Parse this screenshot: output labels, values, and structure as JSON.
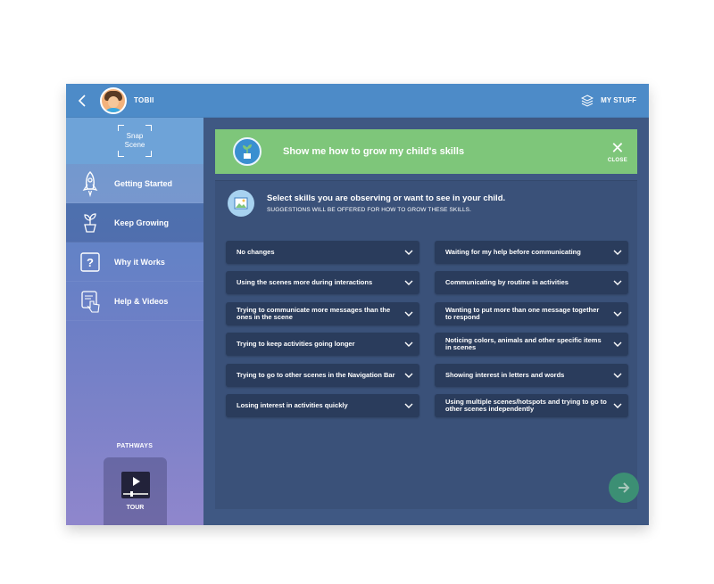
{
  "header": {
    "user_name": "TOBII",
    "my_stuff_label": "MY STUFF"
  },
  "sidebar": {
    "logo_line1": "Snap",
    "logo_line2": "Scene",
    "items": [
      {
        "label": "Getting Started",
        "icon": "rocket-icon"
      },
      {
        "label": "Keep Growing",
        "icon": "plant-icon"
      },
      {
        "label": "Why it Works",
        "icon": "question-icon"
      },
      {
        "label": "Help & Videos",
        "icon": "hand-touch-icon"
      }
    ],
    "pathways_label": "PATHWAYS",
    "tour_label": "TOUR"
  },
  "banner": {
    "title": "Show me how to grow my child's skills",
    "close_label": "CLOSE"
  },
  "panel": {
    "title": "Select skills you are observing or want to see in your child.",
    "subtitle": "SUGGESTIONS WILL BE OFFERED FOR HOW TO GROW THESE SKILLS."
  },
  "skills": [
    "No changes",
    "Waiting for my help before communicating",
    "Using the scenes more during interactions",
    "Communicating by routine in activities",
    "Trying to communicate more messages than the ones in the scene",
    "Wanting to put more than one message together to respond",
    "Trying to keep activities going longer",
    "Noticing colors, animals and other specific items in scenes",
    "Trying to go to other scenes in the Navigation Bar",
    "Showing interest in letters and words",
    "Losing interest in activities quickly",
    "Using multiple scenes/hotspots and trying to go to other scenes independently"
  ],
  "colors": {
    "banner_green": "#7ec67a",
    "panel_bg": "#3a5179",
    "skill_bg": "#2a3c5c",
    "next_button": "#3c8f74"
  }
}
